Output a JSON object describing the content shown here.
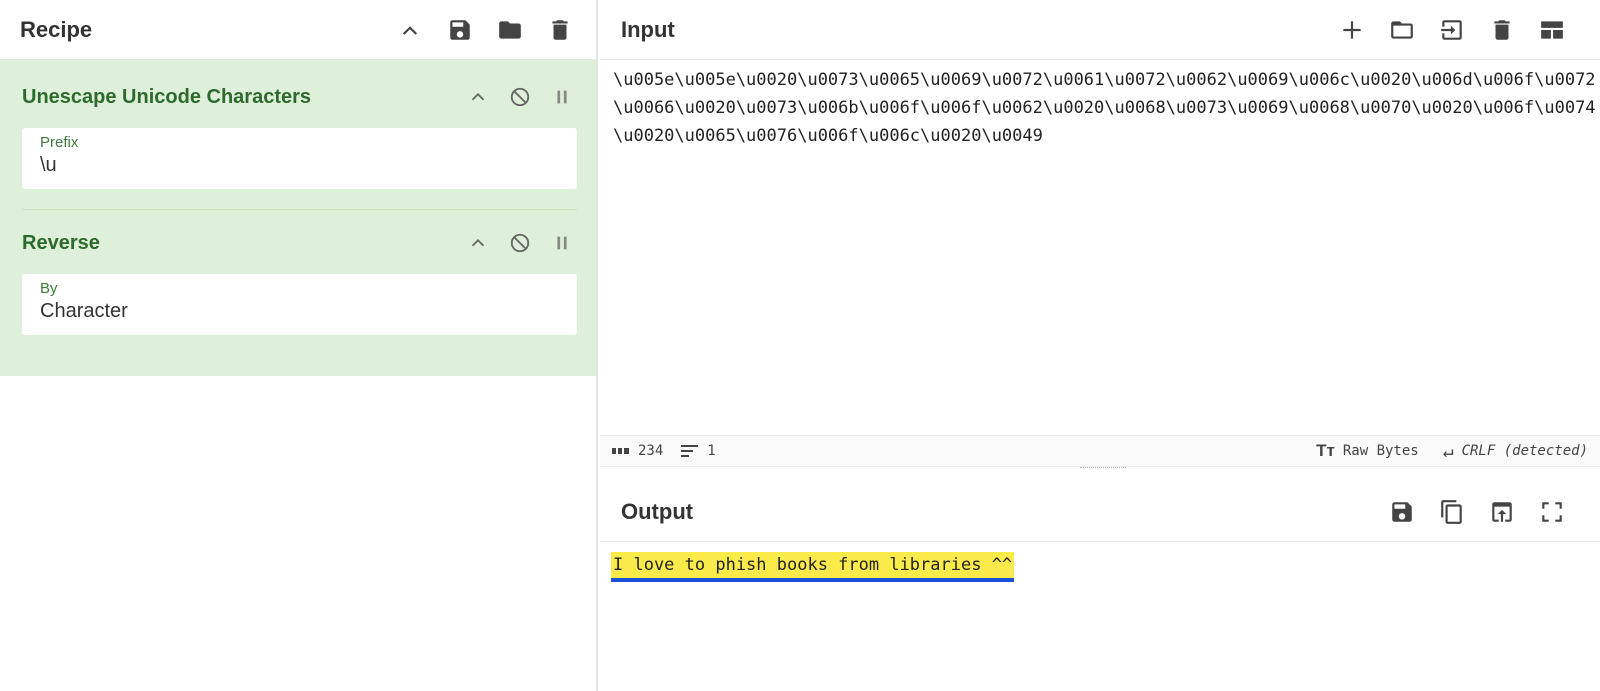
{
  "recipe": {
    "title": "Recipe",
    "header_icons": [
      "chevron-up-icon",
      "save-icon",
      "folder-icon",
      "trash-icon"
    ],
    "operations": [
      {
        "name": "Unescape Unicode Characters",
        "arg_label": "Prefix",
        "arg_value": "\\u"
      },
      {
        "name": "Reverse",
        "arg_label": "By",
        "arg_value": "Character"
      }
    ]
  },
  "input": {
    "title": "Input",
    "header_icons": [
      "plus-icon",
      "folder-icon",
      "import-icon",
      "trash-icon",
      "layout-icon"
    ],
    "text": "\\u005e\\u005e\\u0020\\u0073\\u0065\\u0069\\u0072\\u0061\\u0072\\u0062\\u0069\\u006c\\u0020\\u006d\\u006f\\u0072\\u0066\\u0020\\u0073\\u006b\\u006f\\u006f\\u0062\\u0020\\u0068\\u0073\\u0069\\u0068\\u0070\\u0020\\u006f\\u0074\\u0020\\u0065\\u0076\\u006f\\u006c\\u0020\\u0049",
    "status": {
      "length": "234",
      "lines": "1",
      "encoding": "Raw Bytes",
      "eol": "CRLF (detected)"
    }
  },
  "output": {
    "title": "Output",
    "header_icons": [
      "save-icon",
      "copy-icon",
      "replace-input-icon",
      "maximize-icon"
    ],
    "text": "I love to phish books from libraries ^^"
  },
  "colors": {
    "recipe_bg": "#dff0da",
    "op_name": "#2d6b2d",
    "highlight": "#fbeb4a",
    "underline": "#1a4fd6"
  }
}
